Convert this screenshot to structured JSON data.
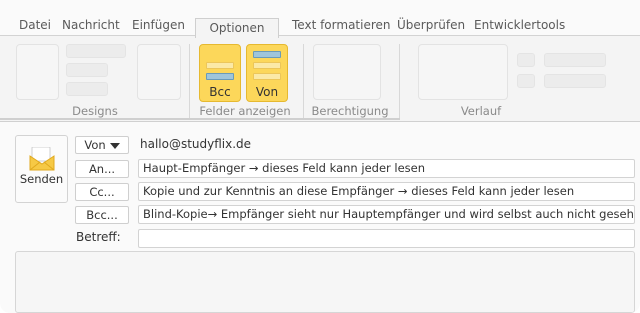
{
  "tabs": [
    "Datei",
    "Nachricht",
    "Einfügen",
    "Optionen",
    "Text formatieren",
    "Überprüfen",
    "Entwicklertools"
  ],
  "active_tab": "Optionen",
  "ribbon": {
    "groups": {
      "designs": "Designs",
      "felder": "Felder anzeigen",
      "berechtigung": "Berechtigung",
      "verlauf": "Verlauf"
    },
    "buttons": {
      "bcc": "Bcc",
      "von": "Von"
    },
    "accent_color": "#fcd75a"
  },
  "compose": {
    "send_label": "Senden",
    "from_button": "Von",
    "from_email": "hallo@studyflix.de",
    "to_button": "An...",
    "to_value": "Haupt-Empfänger → dieses Feld kann jeder lesen",
    "cc_button": "Cc...",
    "cc_value": "Kopie und zur Kenntnis an diese Empfänger → dieses Feld kann jeder lesen",
    "bcc_button": "Bcc...",
    "bcc_value": "Blind-Kopie→ Empfänger sieht nur Hauptempfänger und wird selbst auch nicht gesehen",
    "subject_label": "Betreff:",
    "subject_value": ""
  }
}
